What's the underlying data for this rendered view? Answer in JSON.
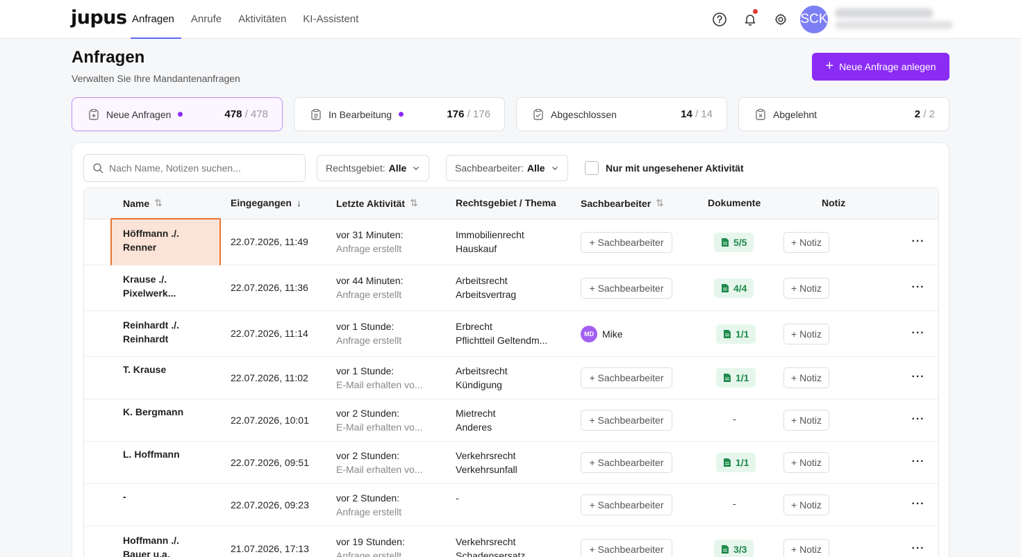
{
  "app": {
    "logo": "jupus",
    "nav": [
      "Anfragen",
      "Anrufe",
      "Aktivitäten",
      "KI-Assistent"
    ],
    "avatar_initials": "SCK"
  },
  "header": {
    "title": "Anfragen",
    "subtitle": "Verwalten Sie Ihre Mandantenanfragen",
    "new_button": "Neue Anfrage anlegen"
  },
  "status_cards": [
    {
      "label": "Neue Anfragen",
      "count": "478",
      "total": "/ 478"
    },
    {
      "label": "In Bearbeitung",
      "count": "176",
      "total": "/ 176"
    },
    {
      "label": "Abgeschlossen",
      "count": "14",
      "total": "/ 14"
    },
    {
      "label": "Abgelehnt",
      "count": "2",
      "total": "/ 2"
    }
  ],
  "filters": {
    "search_placeholder": "Nach Name, Notizen suchen...",
    "rechtsgebiet_label": "Rechtsgebiet:",
    "rechtsgebiet_value": "Alle",
    "sachbearbeiter_label": "Sachbearbeiter:",
    "sachbearbeiter_value": "Alle",
    "unseen_label": "Nur mit ungesehener Aktivität"
  },
  "columns": {
    "name": "Name",
    "eingegangen": "Eingegangen",
    "aktivitaet": "Letzte Aktivität",
    "rechtsgebiet": "Rechtsgebiet / Thema",
    "sachbearbeiter": "Sachbearbeiter",
    "dokumente": "Dokumente",
    "notiz": "Notiz"
  },
  "buttons": {
    "add_sachbearbeiter": "+ Sachbearbeiter",
    "add_notiz": "+ Notiz",
    "more": "···"
  },
  "rows": [
    {
      "name1": "Höffmann ./.",
      "name2": "Renner",
      "date": "22.07.2026, 11:49",
      "act1": "vor 31 Minuten:",
      "act2": "Anfrage erstellt",
      "area1": "Immobilienrecht",
      "area2": "Hauskauf",
      "assignee": "",
      "assignee_initials": "",
      "docs": "5/5"
    },
    {
      "name1": "Krause ./.",
      "name2": "Pixelwerk...",
      "date": "22.07.2026, 11:36",
      "act1": "vor 44 Minuten:",
      "act2": "Anfrage erstellt",
      "area1": "Arbeitsrecht",
      "area2": "Arbeitsvertrag",
      "assignee": "",
      "assignee_initials": "",
      "docs": "4/4"
    },
    {
      "name1": "Reinhardt ./.",
      "name2": "Reinhardt",
      "date": "22.07.2026, 11:14",
      "act1": "vor 1 Stunde:",
      "act2": "Anfrage erstellt",
      "area1": "Erbrecht",
      "area2": "Pflichtteil Geltendm...",
      "assignee": "Mike",
      "assignee_initials": "MD",
      "docs": "1/1"
    },
    {
      "name1": "T. Krause",
      "name2": "",
      "date": "22.07.2026, 11:02",
      "act1": "vor 1 Stunde:",
      "act2": "E-Mail erhalten vo...",
      "area1": "Arbeitsrecht",
      "area2": "Kündigung",
      "assignee": "",
      "assignee_initials": "",
      "docs": "1/1"
    },
    {
      "name1": "K. Bergmann",
      "name2": "",
      "date": "22.07.2026, 10:01",
      "act1": "vor 2 Stunden:",
      "act2": "E-Mail erhalten vo...",
      "area1": "Mietrecht",
      "area2": "Anderes",
      "assignee": "",
      "assignee_initials": "",
      "docs": "-"
    },
    {
      "name1": "L. Hoffmann",
      "name2": "",
      "date": "22.07.2026, 09:51",
      "act1": "vor 2 Stunden:",
      "act2": "E-Mail erhalten vo...",
      "area1": "Verkehrsrecht",
      "area2": "Verkehrsunfall",
      "assignee": "",
      "assignee_initials": "",
      "docs": "1/1"
    },
    {
      "name1": "-",
      "name2": "",
      "date": "22.07.2026, 09:23",
      "act1": "vor 2 Stunden:",
      "act2": "Anfrage erstellt",
      "area1": "-",
      "area2": "",
      "assignee": "",
      "assignee_initials": "",
      "docs": "-"
    },
    {
      "name1": "Hoffmann ./.",
      "name2": "Bauer u.a.",
      "date": "21.07.2026, 17:13",
      "act1": "vor 19 Stunden:",
      "act2": "Anfrage erstellt",
      "area1": "Verkehrsrecht",
      "area2": "Schadensersatz",
      "assignee": "",
      "assignee_initials": "",
      "docs": "3/3"
    }
  ]
}
